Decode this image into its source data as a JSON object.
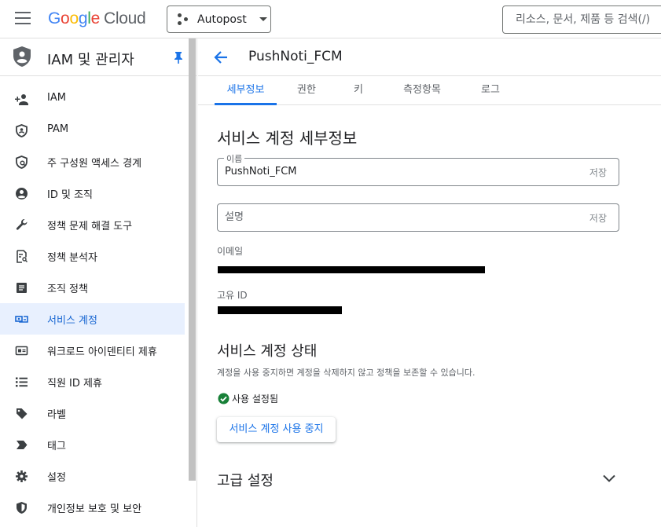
{
  "header": {
    "logo_letters": [
      "G",
      "o",
      "o",
      "g",
      "l",
      "e"
    ],
    "logo_cloud": "Cloud",
    "project": "Autopost",
    "search_placeholder": "리소스, 문서, 제품 등 검색(/)"
  },
  "sidebar": {
    "title": "IAM 및 관리자",
    "items": [
      {
        "label": "IAM",
        "icon": "person-add-icon"
      },
      {
        "label": "PAM",
        "icon": "shield-icon"
      },
      {
        "label": "주 구성원 액세스 경계",
        "icon": "policy-shield-icon"
      },
      {
        "label": "ID 및 조직",
        "icon": "account-circle-icon"
      },
      {
        "label": "정책 문제 해결 도구",
        "icon": "wrench-icon"
      },
      {
        "label": "정책 분석자",
        "icon": "document-search-icon"
      },
      {
        "label": "조직 정책",
        "icon": "list-alt-icon"
      },
      {
        "label": "서비스 계정",
        "icon": "service-account-icon",
        "active": true
      },
      {
        "label": "워크로드 아이덴티티 제휴",
        "icon": "badge-icon"
      },
      {
        "label": "직원 ID 제휴",
        "icon": "list-icon"
      },
      {
        "label": "라벨",
        "icon": "label-icon"
      },
      {
        "label": "태그",
        "icon": "tag-chevron-icon"
      },
      {
        "label": "설정",
        "icon": "gear-icon"
      },
      {
        "label": "개인정보 보호 및 보안",
        "icon": "security-shield-icon"
      }
    ]
  },
  "page": {
    "title": "PushNoti_FCM",
    "tabs": [
      "세부정보",
      "권한",
      "키",
      "측정항목",
      "로그"
    ],
    "active_tab": 0,
    "details_heading": "서비스 계정 세부정보",
    "name_label": "이름",
    "name_value": "PushNoti_FCM",
    "save_label": "저장",
    "description_placeholder": "설명",
    "email_label": "이메일",
    "unique_id_label": "고유 ID",
    "status_heading": "서비스 계정 상태",
    "status_note": "계정을 사용 중지하면 계정을 삭제하지 않고 정책을 보존할 수 있습니다.",
    "status_value": "사용 설정됨",
    "disable_button": "서비스 계정 사용 중지",
    "advanced_heading": "고급 설정"
  },
  "colors": {
    "accent": "#1a73e8",
    "active_bg": "#e8f0fe",
    "enabled_green": "#188038"
  }
}
